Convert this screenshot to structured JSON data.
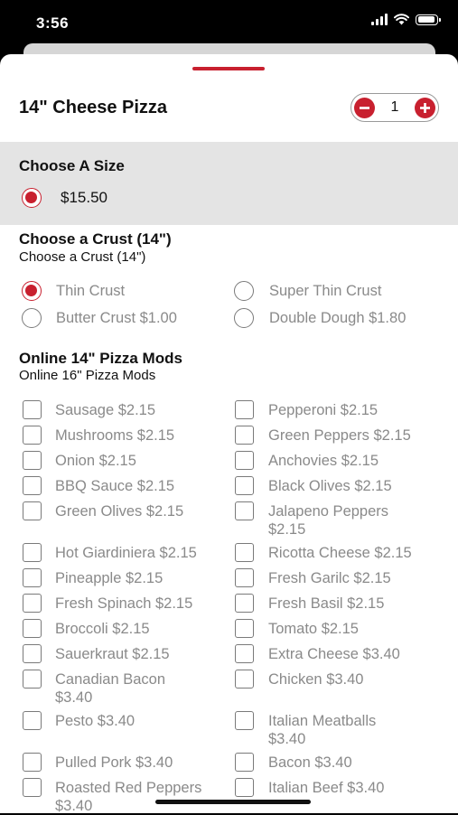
{
  "status_bar": {
    "time": "3:56"
  },
  "item": {
    "title": "14\" Cheese Pizza",
    "quantity": "1",
    "minus_label": "−",
    "plus_label": "+"
  },
  "size_section": {
    "title": "Choose A Size",
    "options": [
      {
        "label": "$15.50",
        "selected": true
      }
    ]
  },
  "crust_section": {
    "title": "Choose a Crust (14\")",
    "subtitle": "Choose a Crust (14\")",
    "options": [
      {
        "label": "Thin Crust",
        "selected": true
      },
      {
        "label": "Super Thin Crust",
        "selected": false
      },
      {
        "label": "Butter Crust $1.00",
        "selected": false
      },
      {
        "label": "Double Dough $1.80",
        "selected": false
      }
    ]
  },
  "mods_section": {
    "title": "Online 14\" Pizza Mods",
    "subtitle": "Online 16\" Pizza Mods",
    "options": [
      {
        "label": "Sausage $2.15"
      },
      {
        "label": "Pepperoni $2.15"
      },
      {
        "label": "Mushrooms $2.15"
      },
      {
        "label": "Green Peppers $2.15"
      },
      {
        "label": "Onion $2.15"
      },
      {
        "label": "Anchovies $2.15"
      },
      {
        "label": "BBQ Sauce $2.15"
      },
      {
        "label": "Black Olives $2.15"
      },
      {
        "label": "Green Olives $2.15"
      },
      {
        "label": "Jalapeno Peppers $2.15"
      },
      {
        "label": "Hot Giardiniera $2.15"
      },
      {
        "label": "Ricotta Cheese $2.15"
      },
      {
        "label": "Pineapple $2.15"
      },
      {
        "label": "Fresh Garilc $2.15"
      },
      {
        "label": "Fresh Spinach $2.15"
      },
      {
        "label": "Fresh Basil $2.15"
      },
      {
        "label": "Broccoli $2.15"
      },
      {
        "label": "Tomato $2.15"
      },
      {
        "label": "Sauerkraut $2.15"
      },
      {
        "label": "Extra Cheese $3.40"
      },
      {
        "label": "Canadian Bacon $3.40"
      },
      {
        "label": "Chicken $3.40"
      },
      {
        "label": "Pesto $3.40"
      },
      {
        "label": "Italian Meatballs $3.40"
      },
      {
        "label": "Pulled Pork $3.40"
      },
      {
        "label": "Bacon $3.40"
      },
      {
        "label": "Roasted Red Peppers $3.40"
      },
      {
        "label": "Italian Beef $3.40"
      }
    ]
  },
  "colors": {
    "accent": "#c8202f",
    "section_bg": "#e4e4e4",
    "option_text": "#8a8a8a"
  }
}
